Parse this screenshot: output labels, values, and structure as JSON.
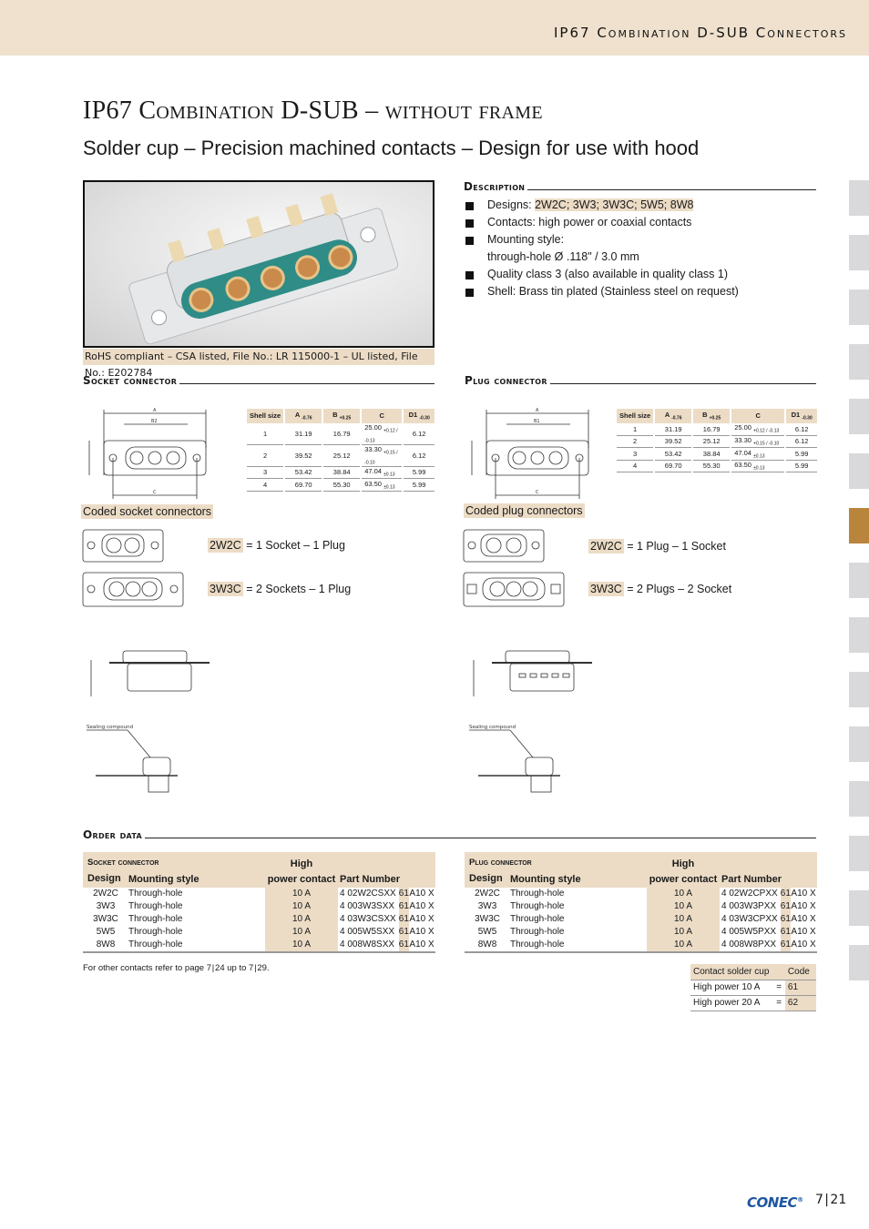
{
  "header": {
    "title": "IP67 Combination D-SUB Connectors"
  },
  "page": {
    "title": "IP67 Combination D-SUB – without frame",
    "subtitle": "Solder cup – Precision machined contacts – Design for use with hood"
  },
  "photo": {
    "alt": "connector-photo",
    "caption": "RoHS compliant – CSA listed, File No.: LR 115000-1 – UL listed, File No.: E202784"
  },
  "description": {
    "heading": "Description",
    "items": [
      {
        "prefix": "Designs: ",
        "highlight": "2W2C; 3W3; 3W3C; 5W5; 8W8"
      },
      {
        "text": "Contacts: high power or coaxial contacts"
      },
      {
        "text": "Mounting style:",
        "text2": "through-hole Ø .118\" / 3.0 mm"
      },
      {
        "text": "Quality class 3 (also available in quality class 1)"
      },
      {
        "text": "Shell: Brass tin plated (Stainless steel on request)"
      }
    ]
  },
  "socket": {
    "heading": "Socket connector",
    "drawing_labels": {
      "a": "A",
      "b": "B2",
      "c": "C"
    },
    "table": {
      "headers": [
        "Shell size",
        "A",
        "-0.76",
        "B",
        "+0.25",
        "C",
        "D1",
        "-0.30"
      ],
      "rows": [
        {
          "size": "1",
          "a": "31.19",
          "b": "16.79",
          "c": "25.00",
          "ctol": "+0.12 / -0.13",
          "d1": "6.12"
        },
        {
          "size": "2",
          "a": "39.52",
          "b": "25.12",
          "c": "33.30",
          "ctol": "+0.15 / -0.10",
          "d1": "6.12"
        },
        {
          "size": "3",
          "a": "53.42",
          "b": "38.84",
          "c": "47.04",
          "ctol": "±0.13",
          "d1": "5.99"
        },
        {
          "size": "4",
          "a": "69.70",
          "b": "55.30",
          "c": "63.50",
          "ctol": "±0.13",
          "d1": "5.99"
        }
      ]
    },
    "coded_heading": "Coded socket connectors",
    "coded": [
      {
        "code": "2W2C",
        "text": " = 1 Socket – 1 Plug"
      },
      {
        "code": "3W3C",
        "text": " = 2 Sockets – 1 Plug"
      }
    ],
    "sealing_label": "Sealing compound"
  },
  "plug": {
    "heading": "Plug connector",
    "drawing_labels": {
      "a": "A",
      "b": "B1",
      "c": "C"
    },
    "table": {
      "headers": [
        "Shell size",
        "A",
        "-0.76",
        "B",
        "+0.25",
        "C",
        "D1",
        "-0.30"
      ],
      "rows": [
        {
          "size": "1",
          "a": "31.19",
          "b": "16.79",
          "c": "25.00",
          "ctol": "+0.12 / -0.13",
          "d1": "6.12"
        },
        {
          "size": "2",
          "a": "39.52",
          "b": "25.12",
          "c": "33.30",
          "ctol": "+0.15 / -0.10",
          "d1": "6.12"
        },
        {
          "size": "3",
          "a": "53.42",
          "b": "38.84",
          "c": "47.04",
          "ctol": "±0.13",
          "d1": "5.99"
        },
        {
          "size": "4",
          "a": "69.70",
          "b": "55.30",
          "c": "63.50",
          "ctol": "±0.13",
          "d1": "5.99"
        }
      ]
    },
    "coded_heading": "Coded plug connectors",
    "coded": [
      {
        "code": "2W2C",
        "text": " = 1 Plug – 1 Socket"
      },
      {
        "code": "3W3C",
        "text": " = 2 Plugs – 2 Socket"
      }
    ],
    "sealing_label": "Sealing compound"
  },
  "order": {
    "heading": "Order data",
    "socket_table": {
      "title": "Socket connector",
      "col_design": "Design",
      "col_mount": "Mounting style",
      "col_hp1": "High",
      "col_hp2": "power contact",
      "col_part": "Part Number",
      "rows": [
        {
          "design": "2W2C",
          "mount": "Through-hole",
          "hp": "10 A",
          "part": "4 02W2CSXX",
          "code": "61",
          "suffix": "A10 X"
        },
        {
          "design": "3W3",
          "mount": "Through-hole",
          "hp": "10 A",
          "part": "4 003W3SXX",
          "code": "61",
          "suffix": "A10 X"
        },
        {
          "design": "3W3C",
          "mount": "Through-hole",
          "hp": "10 A",
          "part": "4 03W3CSXX",
          "code": "61",
          "suffix": "A10 X"
        },
        {
          "design": "5W5",
          "mount": "Through-hole",
          "hp": "10 A",
          "part": "4 005W5SXX",
          "code": "61",
          "suffix": "A10 X"
        },
        {
          "design": "8W8",
          "mount": "Through-hole",
          "hp": "10 A",
          "part": "4 008W8SXX",
          "code": "61",
          "suffix": "A10 X"
        }
      ]
    },
    "plug_table": {
      "title": "Plug connector",
      "col_design": "Design",
      "col_mount": "Mounting style",
      "col_hp1": "High",
      "col_hp2": "power contact",
      "col_part": "Part Number",
      "rows": [
        {
          "design": "2W2C",
          "mount": "Through-hole",
          "hp": "10 A",
          "part": "4 02W2CPXX",
          "code": "61",
          "suffix": "A10 X"
        },
        {
          "design": "3W3",
          "mount": "Through-hole",
          "hp": "10 A",
          "part": "4 003W3PXX",
          "code": "61",
          "suffix": "A10 X"
        },
        {
          "design": "3W3C",
          "mount": "Through-hole",
          "hp": "10 A",
          "part": "4 03W3CPXX",
          "code": "61",
          "suffix": "A10 X"
        },
        {
          "design": "5W5",
          "mount": "Through-hole",
          "hp": "10 A",
          "part": "4 005W5PXX",
          "code": "61",
          "suffix": "A10 X"
        },
        {
          "design": "8W8",
          "mount": "Through-hole",
          "hp": "10 A",
          "part": "4 008W8PXX",
          "code": "61",
          "suffix": "A10 X"
        }
      ]
    },
    "note": "For other contacts refer to page 7 | 24 up to 7 | 29.",
    "code_table": {
      "col1": "Contact solder cup",
      "col2": "Code",
      "rows": [
        {
          "label": "High power 10 A",
          "eq": "=",
          "code": "61"
        },
        {
          "label": "High power 20 A",
          "eq": "=",
          "code": "62"
        }
      ]
    }
  },
  "side_tabs": {
    "count": 15,
    "active_index": 6,
    "active_color": "#b9853c",
    "inactive_color": "#d9d9db"
  },
  "footer": {
    "brand": "CONEC",
    "registered": "®",
    "page": "7 | 21"
  }
}
